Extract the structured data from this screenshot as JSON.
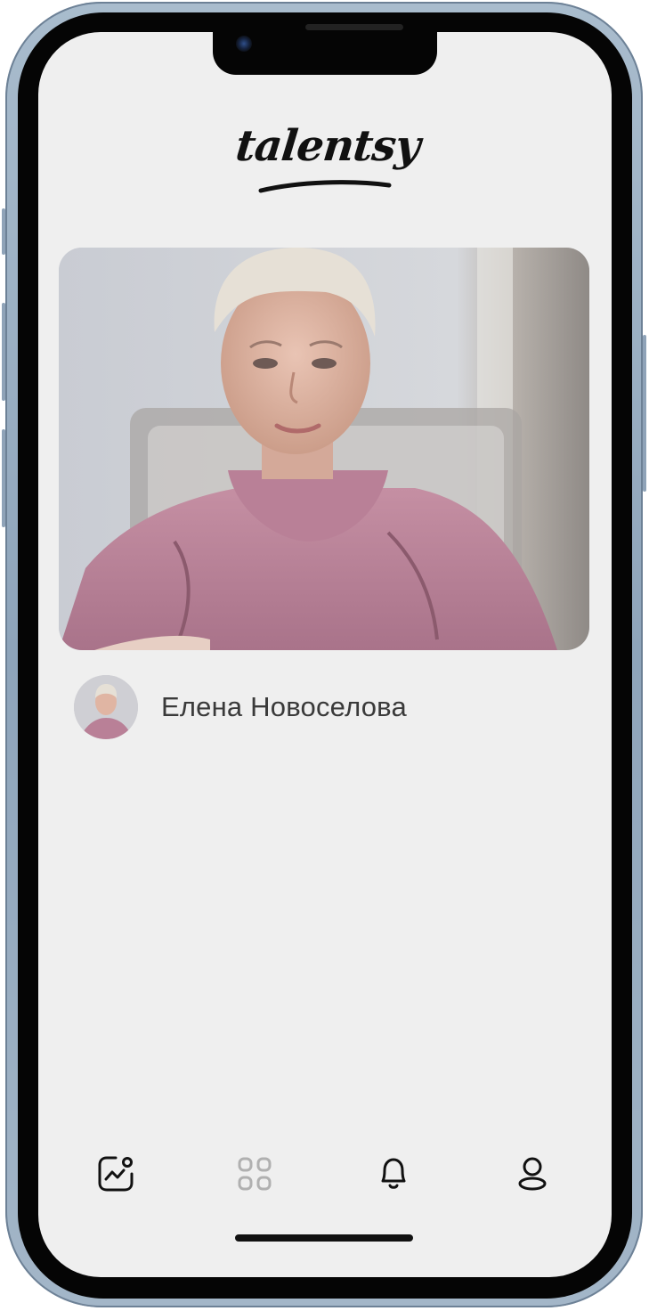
{
  "app": {
    "logo_text": "talentsy"
  },
  "post": {
    "author_name": "Елена Новоселова",
    "cover_alt": "Елена Новоселова"
  },
  "tabbar": {
    "items": [
      {
        "icon": "analytics-icon",
        "active": true
      },
      {
        "icon": "grid-icon",
        "active": false
      },
      {
        "icon": "bell-icon",
        "active": true
      },
      {
        "icon": "profile-icon",
        "active": true
      }
    ]
  },
  "colors": {
    "background": "#efefef",
    "text": "#3a3a3a",
    "icon_active": "#111111",
    "icon_inactive": "#b0b0b0",
    "frame": "#9fb3c6"
  }
}
